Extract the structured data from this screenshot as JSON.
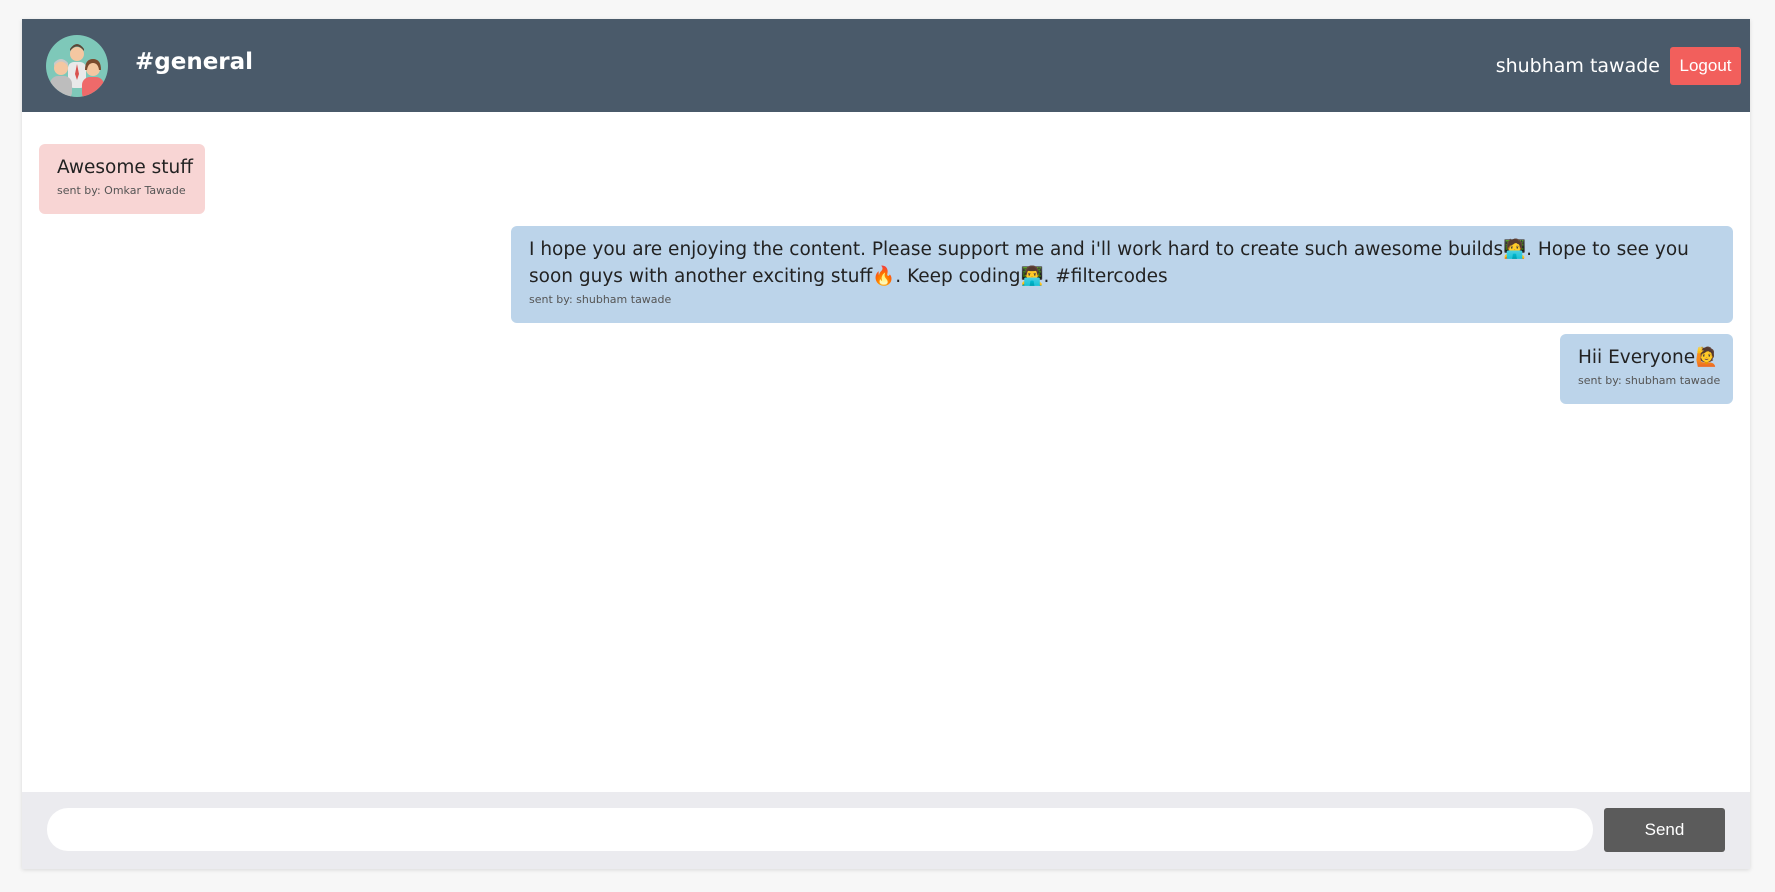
{
  "header": {
    "channel": "#general",
    "user_name": "shubham tawade",
    "logout_label": "Logout"
  },
  "messages": [
    {
      "text": "Awesome stuff",
      "meta": "sent by: Omkar Tawade",
      "direction": "received"
    },
    {
      "text": "I hope you are enjoying the content. Please support me and i'll work hard to create such awesome builds🧑‍💻. Hope to see you soon guys with another exciting stuff🔥. Keep coding👨‍💻. #filtercodes",
      "meta": "sent by: shubham tawade",
      "direction": "sent"
    },
    {
      "text": "Hii Everyone🙋",
      "meta": "sent by: shubham tawade",
      "direction": "sent"
    }
  ],
  "composer": {
    "value": "",
    "placeholder": "",
    "send_label": "Send"
  },
  "colors": {
    "header_bg": "#4a5a6a",
    "logout_bg": "#f25f5c",
    "received_bubble": "#f8d5d4",
    "sent_bubble": "#bcd4ea",
    "footer_bg": "#ebebef",
    "send_bg": "#5b5b5b"
  },
  "icons": {
    "channel_avatar": "group-avatar-icon"
  }
}
